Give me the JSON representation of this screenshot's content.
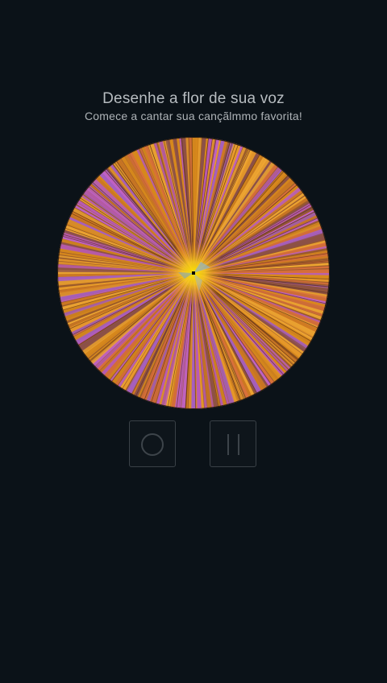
{
  "header": {
    "title": "Desenhe a flor de sua voz",
    "subtitle": "Comece a cantar sua cançãlmmo favorita!"
  },
  "flower": {
    "ray_colors": [
      "#d98a1c",
      "#c062c9",
      "#e89a2a",
      "#b85ab8",
      "#d9703a",
      "#a65fc0",
      "#f0a732",
      "#cf7a22",
      "#8a4f4a"
    ],
    "center_color": "#ffdd00",
    "edge_color": "#3a2a1a"
  },
  "controls": {
    "record_icon": "record-circle-icon",
    "pause_icon": "pause-icon",
    "border_color": "#3a4147"
  }
}
